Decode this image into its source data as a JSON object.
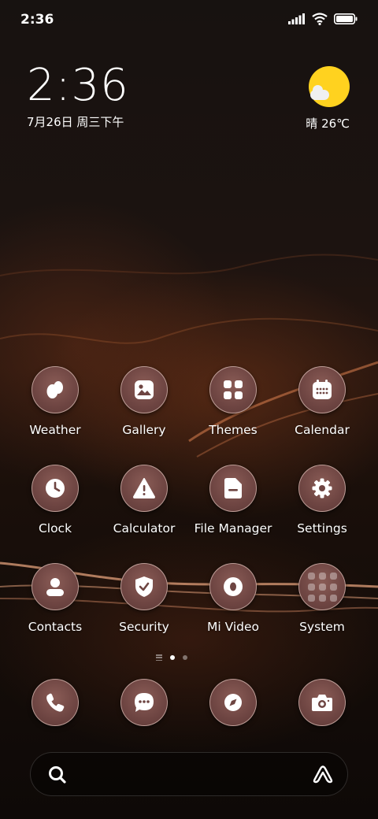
{
  "status_bar": {
    "time": "2:36",
    "icons": [
      "signal-icon",
      "wifi-icon",
      "battery-icon"
    ]
  },
  "clock_widget": {
    "time": "2:36",
    "date": "7月26日 周三下午"
  },
  "weather_widget": {
    "condition_icon": "sun-cloud-icon",
    "text": "晴 26℃"
  },
  "apps": [
    {
      "label": "Weather",
      "icon": "weather-icon"
    },
    {
      "label": "Gallery",
      "icon": "gallery-icon"
    },
    {
      "label": "Themes",
      "icon": "themes-icon"
    },
    {
      "label": "Calendar",
      "icon": "calendar-icon"
    },
    {
      "label": "Clock",
      "icon": "clock-icon"
    },
    {
      "label": "Calculator",
      "icon": "calculator-icon"
    },
    {
      "label": "File Manager",
      "icon": "file-manager-icon"
    },
    {
      "label": "Settings",
      "icon": "settings-icon"
    },
    {
      "label": "Contacts",
      "icon": "contacts-icon"
    },
    {
      "label": "Security",
      "icon": "security-icon"
    },
    {
      "label": "Mi Video",
      "icon": "mi-video-icon"
    },
    {
      "label": "System",
      "icon": "folder-icon"
    }
  ],
  "page_indicator": {
    "pages": 2,
    "current": 1
  },
  "dock": [
    {
      "icon": "phone-icon"
    },
    {
      "icon": "messages-icon"
    },
    {
      "icon": "browser-icon"
    },
    {
      "icon": "camera-icon"
    }
  ],
  "search_bar": {
    "search_icon": "search-icon",
    "assistant_icon": "assistant-icon"
  },
  "colors": {
    "icon_bg": "#6e4542",
    "sun": "#ffd21f",
    "wallpaper_accent": "#b8673a"
  }
}
